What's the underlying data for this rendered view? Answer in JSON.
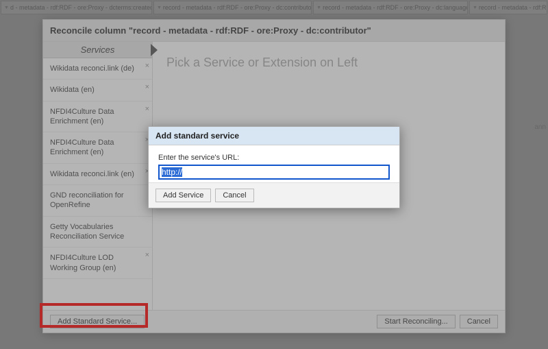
{
  "tabs": [
    "d - metadata - rdf:RDF - ore:Proxy - dcterms:created",
    "record - metadata - rdf:RDF - ore:Proxy - dc:contributor",
    "record - metadata - rdf:RDF - ore:Proxy - dc:language",
    "record - metadata - rdf:R"
  ],
  "bg_cell": "ann",
  "dialog": {
    "title": "Reconcile column \"record - metadata - rdf:RDF - ore:Proxy - dc:contributor\"",
    "services_header": "Services",
    "services": [
      {
        "label": "Wikidata reconci.link (de)",
        "removable": true
      },
      {
        "label": "Wikidata (en)",
        "removable": true
      },
      {
        "label": "NFDI4Culture Data Enrichment (en)",
        "removable": true
      },
      {
        "label": "NFDI4Culture Data Enrichment (en)",
        "removable": true
      },
      {
        "label": "Wikidata reconci.link (en)",
        "removable": true
      },
      {
        "label": "GND reconciliation for OpenRefine",
        "removable": false
      },
      {
        "label": "Getty Vocabularies Reconciliation Service",
        "removable": false
      },
      {
        "label": "NFDI4Culture LOD Working Group (en)",
        "removable": true
      }
    ],
    "main_hint": "Pick a Service or Extension on Left",
    "footer": {
      "add": "Add Standard Service...",
      "start": "Start Reconciling...",
      "cancel": "Cancel"
    }
  },
  "modal": {
    "title": "Add standard service",
    "label": "Enter the service's URL:",
    "value": "http://",
    "add": "Add Service",
    "cancel": "Cancel"
  }
}
